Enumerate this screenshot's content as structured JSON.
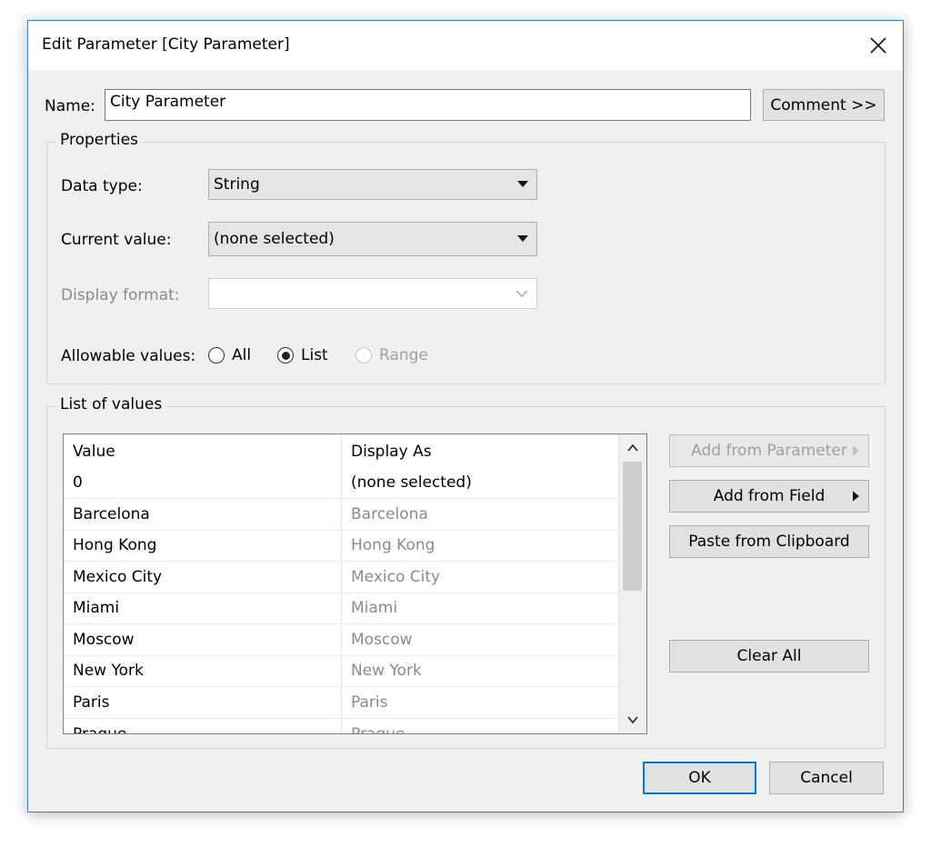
{
  "dialog": {
    "title": "Edit Parameter [City Parameter]"
  },
  "name_row": {
    "label": "Name:",
    "value": "City Parameter",
    "comment_button": "Comment >>"
  },
  "properties": {
    "legend": "Properties",
    "data_type": {
      "label": "Data type:",
      "value": "String"
    },
    "current_value": {
      "label": "Current value:",
      "value": "(none selected)"
    },
    "display_format": {
      "label": "Display format:",
      "value": ""
    },
    "allowable_values": {
      "label": "Allowable values:",
      "options": [
        {
          "label": "All",
          "selected": false,
          "enabled": true
        },
        {
          "label": "List",
          "selected": true,
          "enabled": true
        },
        {
          "label": "Range",
          "selected": false,
          "enabled": false
        }
      ]
    }
  },
  "list_of_values": {
    "legend": "List of values",
    "columns": [
      "Value",
      "Display As"
    ],
    "rows": [
      {
        "value": "0",
        "display": "(none selected)"
      },
      {
        "value": "Barcelona",
        "display": "Barcelona"
      },
      {
        "value": "Hong Kong",
        "display": "Hong Kong"
      },
      {
        "value": "Mexico City",
        "display": "Mexico City"
      },
      {
        "value": "Miami",
        "display": "Miami"
      },
      {
        "value": "Moscow",
        "display": "Moscow"
      },
      {
        "value": "New York",
        "display": "New York"
      },
      {
        "value": "Paris",
        "display": "Paris"
      },
      {
        "value": "Prague",
        "display": "Prague"
      }
    ],
    "buttons": {
      "add_from_parameter": "Add from Parameter",
      "add_from_field": "Add from Field",
      "paste_from_clipboard": "Paste from Clipboard",
      "clear_all": "Clear All"
    }
  },
  "footer": {
    "ok": "OK",
    "cancel": "Cancel"
  },
  "icons": {
    "close": "close-icon",
    "dropdown": "caret-down-icon",
    "submenu": "caret-right-icon",
    "scroll_up": "chevron-up-icon",
    "scroll_down": "chevron-down-icon"
  },
  "colors": {
    "accent_border": "#0078d7",
    "window_border": "#3c7fc0",
    "face": "#f0f0f0"
  }
}
